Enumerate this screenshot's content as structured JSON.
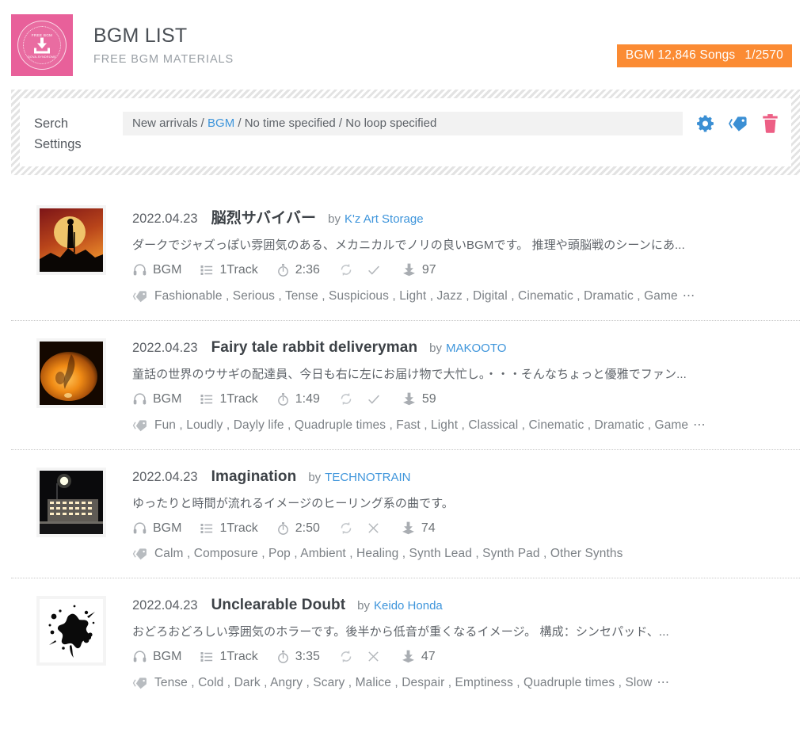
{
  "header": {
    "logo": {
      "alt": "free-bgm-dova-syndrome-seal",
      "seal_top_text": "FREE BGM",
      "seal_bottom_text": "DOVA-SYNDROME",
      "bg_color": "#e8609a"
    },
    "title": "BGM LIST",
    "subtitle": "FREE BGM MATERIALS",
    "badge": {
      "count_label": "BGM 12,846 Songs",
      "page_label": "1/2570",
      "color": "#fb8b33"
    }
  },
  "search": {
    "label_line1": "Serch",
    "label_line2": "Settings",
    "crumb_prefix": "New arrivals / ",
    "crumb_highlight": "BGM",
    "crumb_suffix": " / No time specified / No loop specified",
    "icons": {
      "gear": "gear-icon",
      "tag": "tag-icon",
      "trash": "trash-icon",
      "gear_color": "#3b8fd4",
      "tag_color": "#3b8fd4",
      "trash_color": "#ed5f85"
    }
  },
  "tracks": [
    {
      "date": "2022.04.23",
      "title": "脳烈サバイバー",
      "by_label": "by",
      "artist": "K'z Art Storage",
      "description": "ダークでジャズっぽい雰囲気のある、メカニカルでノリの良いBGMです。 推理や頭脳戦のシーンにあ...",
      "category": "BGM",
      "tracks_count": "1Track",
      "duration": "2:36",
      "loop": "check",
      "downloads": "97",
      "tags": "Fashionable , Serious , Tense , Suspicious , Light , Jazz , Digital , Cinematic , Dramatic , Game",
      "tags_more": "⋯",
      "thumb": "moon-silhouette"
    },
    {
      "date": "2022.04.23",
      "title": "Fairy tale rabbit deliveryman",
      "by_label": "by",
      "artist": "MAKOOTO",
      "description": "童話の世界のウサギの配達員、今日も右に左にお届け物で大忙し。・・・そんなちょっと優雅でファン...",
      "category": "BGM",
      "tracks_count": "1Track",
      "duration": "1:49",
      "loop": "check",
      "downloads": "59",
      "tags": "Fun , Loudly , Dayly life , Quadruple times , Fast , Light , Classical , Cinematic , Dramatic , Game",
      "tags_more": "⋯",
      "thumb": "orange-flame"
    },
    {
      "date": "2022.04.23",
      "title": "Imagination",
      "by_label": "by",
      "artist": "TECHNOTRAIN",
      "description": "ゆったりと時間が流れるイメージのヒーリング系の曲です。",
      "category": "BGM",
      "tracks_count": "1Track",
      "duration": "2:50",
      "loop": "cross",
      "downloads": "74",
      "tags": "Calm , Composure , Pop , Ambient , Healing , Synth Lead , Synth Pad , Other Synths",
      "tags_more": "",
      "thumb": "night-building"
    },
    {
      "date": "2022.04.23",
      "title": "Unclearable Doubt",
      "by_label": "by",
      "artist": "Keido Honda",
      "description": "おどろおどろしい雰囲気のホラーです。後半から低音が重くなるイメージ。 構成：シンセパッド、...",
      "category": "BGM",
      "tracks_count": "1Track",
      "duration": "3:35",
      "loop": "cross",
      "downloads": "47",
      "tags": "Tense , Cold , Dark , Angry , Scary , Malice , Despair , Emptiness , Quadruple times , Slow",
      "tags_more": "⋯",
      "thumb": "ink-splatter"
    }
  ]
}
